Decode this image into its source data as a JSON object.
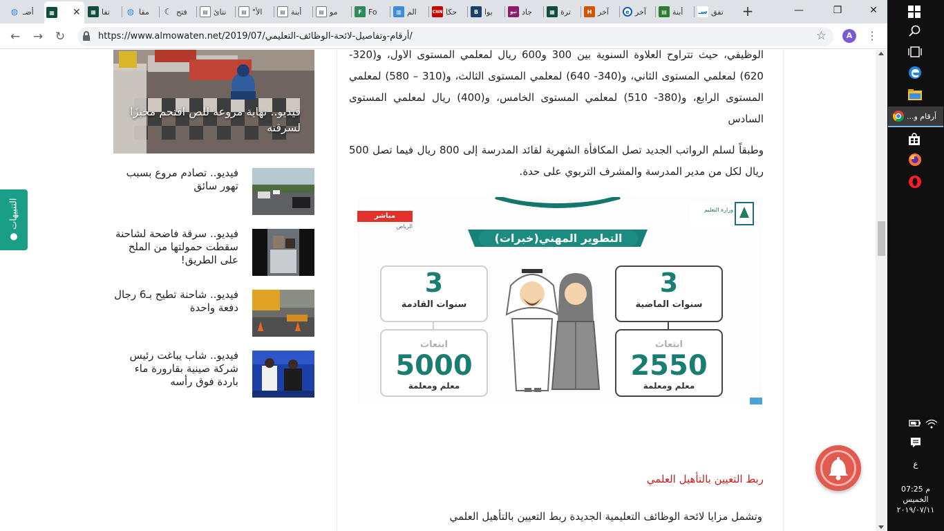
{
  "browser": {
    "tabs": [
      {
        "label": "تفق",
        "fav_color": "#0b78d0",
        "fav_text": "سـ"
      },
      {
        "label": "أبنة",
        "fav_color": "#2e7d32",
        "fav_text": "▤"
      },
      {
        "label": "آخر",
        "fav_color": "#e0e0e0",
        "fav_text": "e"
      },
      {
        "label": "آخر",
        "fav_color": "#d35400",
        "fav_text": "H"
      },
      {
        "label": "ترة",
        "fav_color": "#0f4c3a",
        "fav_text": "▦"
      },
      {
        "label": "جاد",
        "fav_color": "#8e1b6b",
        "fav_text": "نيو"
      },
      {
        "label": "بوا",
        "fav_color": "#1a3e6e",
        "fav_text": "B"
      },
      {
        "label": "حكا",
        "fav_color": "#cc0000",
        "fav_text": "CNN"
      },
      {
        "label": "الم",
        "fav_color": "#3a8dde",
        "fav_text": "▥"
      },
      {
        "label": "Fo",
        "fav_color": "#2e8b57",
        "fav_text": "F"
      },
      {
        "label": "مو",
        "fav_color": "#7b7b7b",
        "fav_text": "▤"
      },
      {
        "label": "أبنة",
        "fav_color": "#7b7b7b",
        "fav_text": "▤"
      },
      {
        "label": "\"الأ",
        "fav_color": "#7b7b7b",
        "fav_text": "▤"
      },
      {
        "label": "نتائ",
        "fav_color": "#7b7b7b",
        "fav_text": "▤"
      },
      {
        "label": "فتح",
        "fav_color": "#3a3a3a",
        "fav_text": "☾"
      },
      {
        "label": "مقا",
        "fav_color": "#3a8dde",
        "fav_text": "◍"
      },
      {
        "label": "تفا",
        "fav_color": "#0f4c3a",
        "fav_text": "▦"
      },
      {
        "label": "",
        "fav_color": "#0f4c3a",
        "fav_text": "▦"
      },
      {
        "label": "أضـ",
        "fav_color": "#3a8dde",
        "fav_text": "◍"
      }
    ],
    "url": "https://www.almowaten.net/2019/07/أرقام-وتفاصيل-لائحة-الوظائف-التعليمي/",
    "profile_initial": "A"
  },
  "article": {
    "para1": "الوظيفي، حيث تتراوح العلاوة السنوية بين 300 و600 ريال لمعلمي المستوى الأول، و(320- 620) لمعلمي المستوى الثاني، و(340- 640) لمعلمي المستوى الثالث، و(310 – 580) لمعلمي المستوى الرابع، و(380- 510) لمعلمي المستوى الخامس، و(400) ريال لمعلمي المستوى السادس",
    "para2": "وطبقاً لسلم الرواتب الجديد تصل المكافأة الشهرية لقائد المدرسة إلى 800 ريال فيما تصل 500 ريال لكل من مدير المدرسة والمشرف التربوي على حدة.",
    "heading": "ربط التعيين بالتأهيل العلمي",
    "para3": "وتشمل مزايا لائحة الوظائف التعليمية الجديدة ربط التعيين بالتأهيل العلمي"
  },
  "infographic": {
    "logo_text": "وزارة التعليم",
    "live_badge": "مباشر",
    "live_city": "الرياض",
    "title": "التطوير المهني(خبرات)",
    "past_number": "3",
    "past_label": "سنوات الماضية",
    "future_number": "3",
    "future_label": "سنوات القادمة",
    "scholarship_label": "ابتعاث",
    "past_count": "2550",
    "future_count": "5000",
    "teachers_label": "معلم ومعلمة"
  },
  "sidebar": {
    "featured_title": "فيديو.. نهاية مروعة للص اقتحم مخبزًا لسرقته",
    "items": [
      {
        "title": "فيديو.. تصادم مروع بسبب تهور سائق"
      },
      {
        "title": "فيديو.. سرقة فاضحة لشاحنة سقطت حمولتها من الملح على الطريق!"
      },
      {
        "title": "فيديو.. شاحنة تطيح بـ6 رجال دفعة واحدة"
      },
      {
        "title": "فيديو.. شاب يباغت رئيس شركة صينية بقارورة ماء باردة فوق رأسه"
      }
    ]
  },
  "notifications_tab": {
    "label": "التنبيهات"
  },
  "taskbar": {
    "active_task": "أرقام و...",
    "time": "07:25 م",
    "day": "الخميس",
    "date": "٢٠١٩/٠٧/١١",
    "lang": "ع"
  }
}
